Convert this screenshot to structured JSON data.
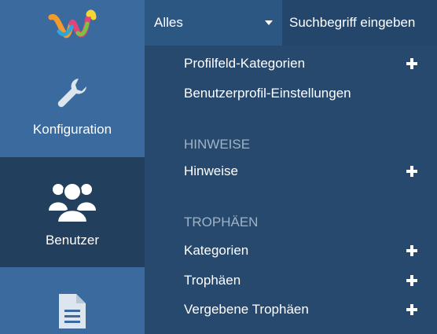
{
  "sidebar": {
    "items": [
      {
        "label": "Konfiguration",
        "icon": "wrench-icon"
      },
      {
        "label": "Benutzer",
        "icon": "users-icon"
      },
      {
        "label": "",
        "icon": "document-icon"
      }
    ]
  },
  "topbar": {
    "select_value": "Alles",
    "search_placeholder": "Suchbegriff eingeben"
  },
  "menu": {
    "sections": [
      {
        "heading": "",
        "items": [
          {
            "label": "Profilfeld-Kategorien",
            "has_add": true
          },
          {
            "label": "Benutzerprofil-Einstellungen",
            "has_add": false
          }
        ]
      },
      {
        "heading": "HINWEISE",
        "items": [
          {
            "label": "Hinweise",
            "has_add": true
          }
        ]
      },
      {
        "heading": "TROPHÄEN",
        "items": [
          {
            "label": "Kategorien",
            "has_add": true
          },
          {
            "label": "Trophäen",
            "has_add": true
          },
          {
            "label": "Vergebene Trophäen",
            "has_add": true
          }
        ]
      }
    ]
  },
  "colors": {
    "sidebar_bg": "#3a6a9e",
    "sidebar_active_bg": "#233f5e",
    "menu_bg": "#26496d",
    "heading_text": "#9fb3c8"
  }
}
